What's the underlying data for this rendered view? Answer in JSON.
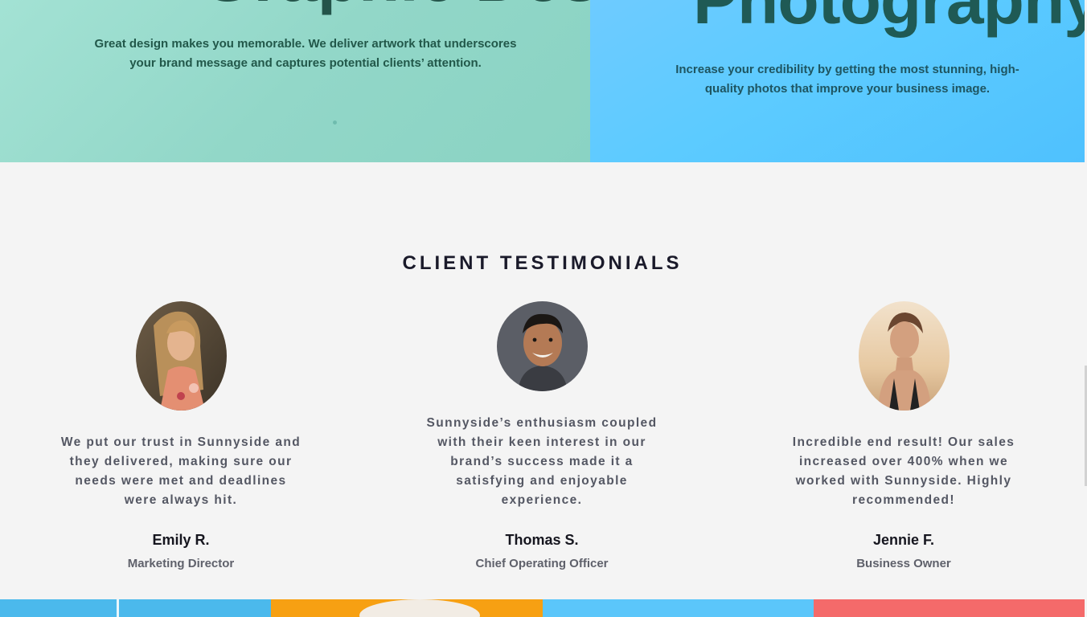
{
  "features": {
    "design": {
      "heading": "Graphic Design",
      "description": "Great design makes you memorable. We deliver artwork that underscores your brand message and captures potential clients’ attention."
    },
    "photography": {
      "heading": "Photography",
      "description": "Increase your credibility by getting the most stunning, high-quality photos that improve your business image."
    }
  },
  "testimonials": {
    "heading": "CLIENT TESTIMONIALS",
    "items": [
      {
        "quote": "We put our trust in Sunnyside and they delivered, making sure our needs were met and deadlines were always hit.",
        "name": "Emily R.",
        "role": "Marketing Director",
        "avatar_icon": "woman-portrait"
      },
      {
        "quote": "Sunnyside’s enthusiasm coupled with their keen interest in our brand’s success made it a satisfying and enjoyable experience.",
        "name": "Thomas S.",
        "role": "Chief Operating Officer",
        "avatar_icon": "man-portrait"
      },
      {
        "quote": "Incredible end result! Our sales increased over 400% when we worked with Sunnyside. Highly recommended!",
        "name": "Jennie F.",
        "role": "Business Owner",
        "avatar_icon": "woman-portrait"
      }
    ]
  },
  "colors": {
    "background": "#f4f4f4",
    "design_panel": "#92d7c8",
    "photo_panel": "#5ccbff",
    "heading_text": "#1a1a2a",
    "quote_text": "#545763"
  }
}
